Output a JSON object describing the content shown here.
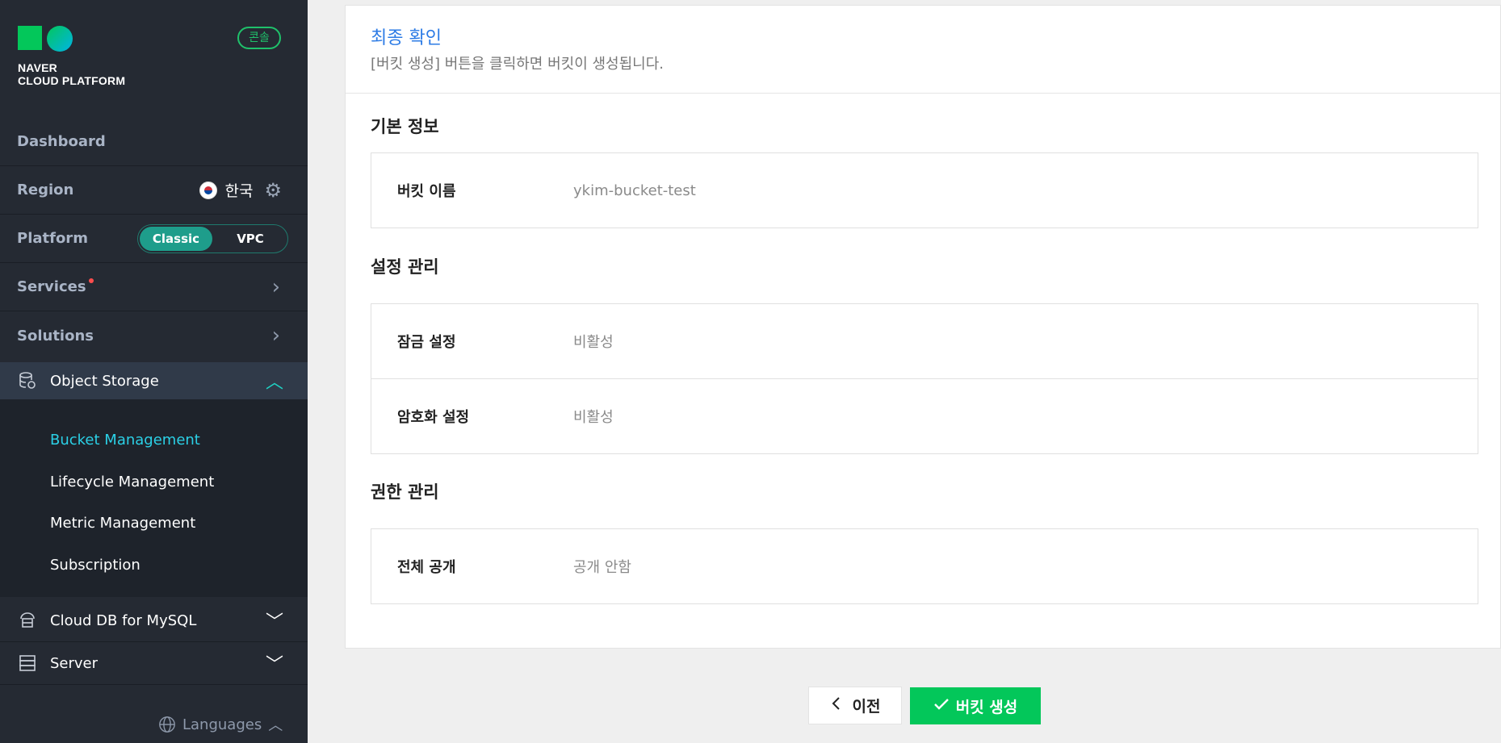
{
  "brand": {
    "name_line1": "NAVER",
    "name_line2": "CLOUD PLATFORM",
    "console_badge": "콘솔",
    "colors": {
      "green": "#03c75a",
      "teal": "#1e9d8b",
      "link_blue": "#2c7be5",
      "active_submenu": "#2bd0e6"
    }
  },
  "sidebar": {
    "dashboard": "Dashboard",
    "region": {
      "label": "Region",
      "value": "한국",
      "icons": [
        "korea-flag-icon",
        "gear-icon"
      ]
    },
    "platform": {
      "label": "Platform",
      "options": [
        "Classic",
        "VPC"
      ],
      "selected": "Classic"
    },
    "services": "Services",
    "solutions": "Solutions",
    "object_storage": {
      "label": "Object Storage",
      "items": [
        "Bucket Management",
        "Lifecycle Management",
        "Metric Management",
        "Subscription"
      ],
      "active": "Bucket Management"
    },
    "groups": [
      "Cloud DB for MySQL",
      "Server"
    ],
    "languages": "Languages"
  },
  "main": {
    "title": "최종 확인",
    "description": "[버킷 생성] 버튼을 클릭하면 버킷이 생성됩니다.",
    "sections": [
      {
        "title": "기본 정보",
        "rows": [
          {
            "label": "버킷 이름",
            "value": "ykim-bucket-test"
          }
        ]
      },
      {
        "title": "설정 관리",
        "rows": [
          {
            "label": "잠금 설정",
            "value": "비활성"
          },
          {
            "label": "암호화 설정",
            "value": "비활성"
          }
        ]
      },
      {
        "title": "권한 관리",
        "rows": [
          {
            "label": "전체 공개",
            "value": "공개 안함"
          }
        ]
      }
    ],
    "buttons": {
      "prev": "이전",
      "create": "버킷 생성"
    }
  }
}
